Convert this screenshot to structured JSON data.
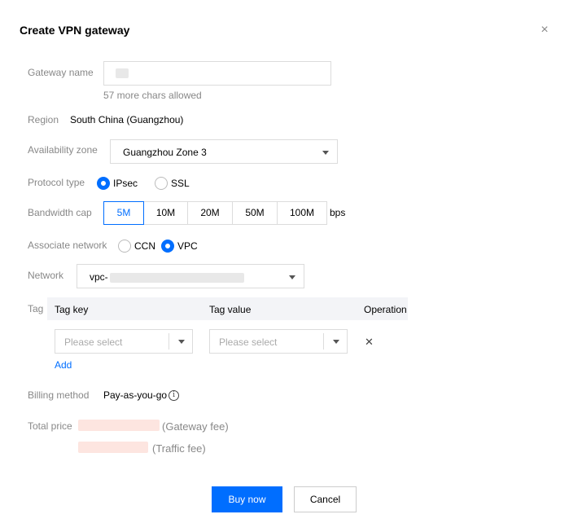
{
  "dialog": {
    "title": "Create VPN gateway",
    "close_icon": "×"
  },
  "gateway_name": {
    "label": "Gateway name",
    "hint": "57 more chars allowed"
  },
  "region": {
    "label": "Region",
    "value": "South China (Guangzhou)"
  },
  "availability_zone": {
    "label": "Availability zone",
    "value": "Guangzhou Zone 3"
  },
  "protocol": {
    "label": "Protocol type",
    "options": [
      {
        "label": "IPsec",
        "selected": true
      },
      {
        "label": "SSL",
        "selected": false
      }
    ]
  },
  "bandwidth": {
    "label": "Bandwidth cap",
    "options": [
      "5M",
      "10M",
      "20M",
      "50M",
      "100M"
    ],
    "selected": "5M",
    "unit": "bps"
  },
  "associate_network": {
    "label": "Associate network",
    "options": [
      {
        "label": "CCN",
        "selected": false
      },
      {
        "label": "VPC",
        "selected": true
      }
    ]
  },
  "network": {
    "label": "Network",
    "value_prefix": "vpc-"
  },
  "tag": {
    "label": "Tag",
    "columns": {
      "key": "Tag key",
      "value": "Tag value",
      "operation": "Operation"
    },
    "key_placeholder": "Please select",
    "value_placeholder": "Please select",
    "delete_icon": "✕",
    "add_label": "Add"
  },
  "billing": {
    "label": "Billing method",
    "value": "Pay-as-you-go",
    "info_icon": "i"
  },
  "total_price": {
    "label": "Total price",
    "gateway_fee": "(Gateway fee)",
    "traffic_fee": "(Traffic fee)"
  },
  "footer": {
    "buy_label": "Buy now",
    "cancel_label": "Cancel"
  },
  "colors": {
    "accent": "#006eff",
    "muted_text": "#888888"
  }
}
